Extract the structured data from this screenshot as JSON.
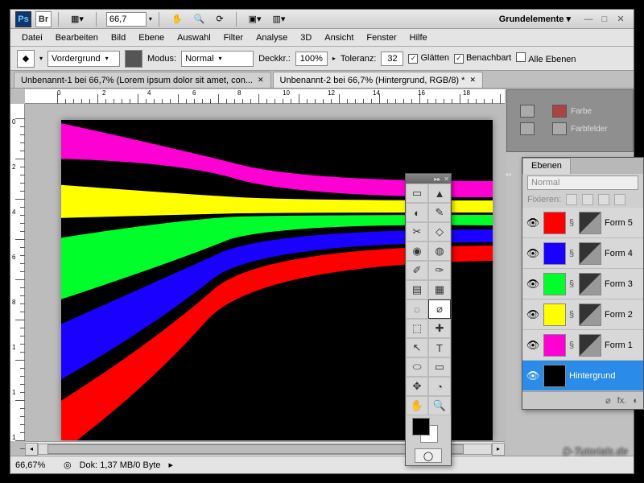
{
  "titlebar": {
    "zoom": "66,7",
    "workspace": "Grundelemente ▾"
  },
  "menu": [
    "Datei",
    "Bearbeiten",
    "Bild",
    "Ebene",
    "Auswahl",
    "Filter",
    "Analyse",
    "3D",
    "Ansicht",
    "Fenster",
    "Hilfe"
  ],
  "options": {
    "fill": "Vordergrund",
    "mode_label": "Modus:",
    "mode": "Normal",
    "opacity_label": "Deckkr.:",
    "opacity": "100%",
    "tolerance_label": "Toleranz:",
    "tolerance": "32",
    "aa": "Glätten",
    "contig": "Benachbart",
    "all": "Alle Ebenen"
  },
  "tabs": [
    "Unbenannt-1 bei 66,7% (Lorem ipsum dolor sit amet, con...",
    "Unbenannt-2 bei 66,7% (Hintergrund, RGB/8) *"
  ],
  "status": {
    "zoom": "66,67%",
    "doc": "Dok: 1,37 MB/0 Byte"
  },
  "side_panels": {
    "farbe": "Farbe",
    "farbfelder": "Farbfelder"
  },
  "layers": {
    "panel_title": "Ebenen",
    "blend": "Normal",
    "lock_label": "Fixieren:",
    "items": [
      {
        "name": "Form 5",
        "color": "#ff0000"
      },
      {
        "name": "Form 4",
        "color": "#1a00ff"
      },
      {
        "name": "Form 3",
        "color": "#00ff2a"
      },
      {
        "name": "Form 2",
        "color": "#ffff00"
      },
      {
        "name": "Form 1",
        "color": "#ff00d4"
      },
      {
        "name": "Hintergrund",
        "color": "#000000"
      }
    ]
  },
  "tool_icons": [
    "▭",
    "▲",
    "◐",
    "✎",
    "✂",
    "◇",
    "◉",
    "◍",
    "✐",
    "✑",
    "▤",
    "▦",
    "◌",
    "⌀",
    "⬚",
    "✚",
    "↖",
    "T",
    "⬭",
    "▭",
    "✥",
    "◔",
    "✋",
    "🔍"
  ],
  "canvas_stripes": [
    {
      "color": "#ff00d4"
    },
    {
      "color": "#ffff00"
    },
    {
      "color": "#00ff2a"
    },
    {
      "color": "#1a00ff"
    },
    {
      "color": "#ff0000"
    }
  ],
  "watermark": "D-Tutorials.de"
}
